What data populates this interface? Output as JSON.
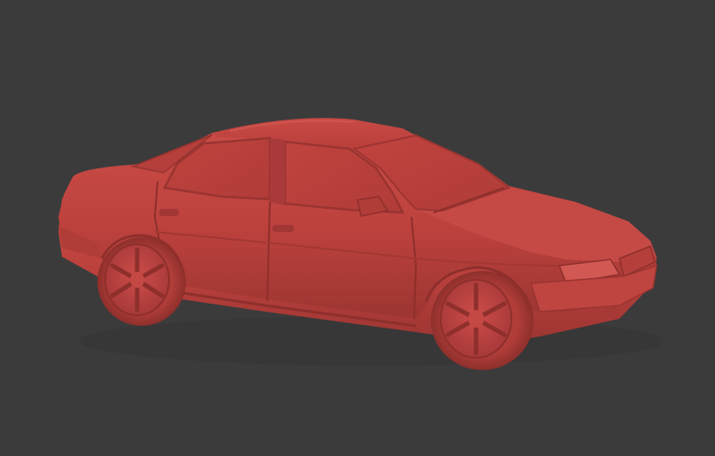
{
  "viewport": {
    "background_color": "#3b3b3b",
    "shading": "clay render",
    "model": {
      "subject": "sedan-car",
      "material_color": "#c0433f",
      "shadow_color": "#8f2f2d",
      "highlight_color": "#d45a54"
    }
  }
}
